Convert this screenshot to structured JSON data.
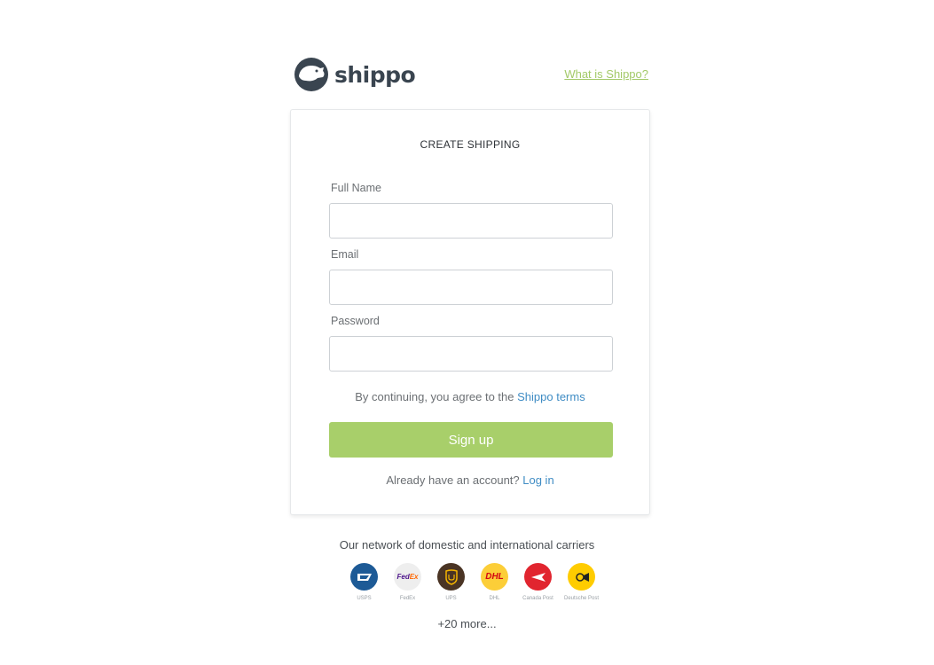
{
  "header": {
    "logo_text": "shippo",
    "what_link": "What is Shippo?"
  },
  "form": {
    "title": "CREATE SHIPPING",
    "full_name_label": "Full Name",
    "full_name_value": "",
    "email_label": "Email",
    "email_value": "",
    "password_label": "Password",
    "password_value": "",
    "terms_prefix": "By continuing, you agree to the ",
    "terms_link": "Shippo terms",
    "signup_label": "Sign up",
    "login_prefix": "Already have an account? ",
    "login_link": "Log in"
  },
  "carriers": {
    "title": "Our network of domestic and international carriers",
    "items": [
      {
        "name": "USPS",
        "icon": "usps-eagle-icon",
        "bg": "#1d5a96",
        "fg": "#ffffff"
      },
      {
        "name": "FedEx",
        "icon": "fedex-logo-icon",
        "bg": "#eeeeee",
        "fg": "#4d148c"
      },
      {
        "name": "UPS",
        "icon": "ups-shield-icon",
        "bg": "#4a3424",
        "fg": "#f4b400"
      },
      {
        "name": "DHL",
        "icon": "dhl-logo-icon",
        "bg": "#fcce38",
        "fg": "#d40511"
      },
      {
        "name": "Canada Post",
        "icon": "canada-post-icon",
        "bg": "#e1252f",
        "fg": "#ffffff"
      },
      {
        "name": "Deutsche Post",
        "icon": "deutsche-post-horn-icon",
        "bg": "#ffcc00",
        "fg": "#222222"
      }
    ],
    "more": "+20 more..."
  },
  "colors": {
    "accent_green": "#a8cf6a",
    "link_blue": "#3f8cc4",
    "logo_dark": "#3a4550"
  }
}
